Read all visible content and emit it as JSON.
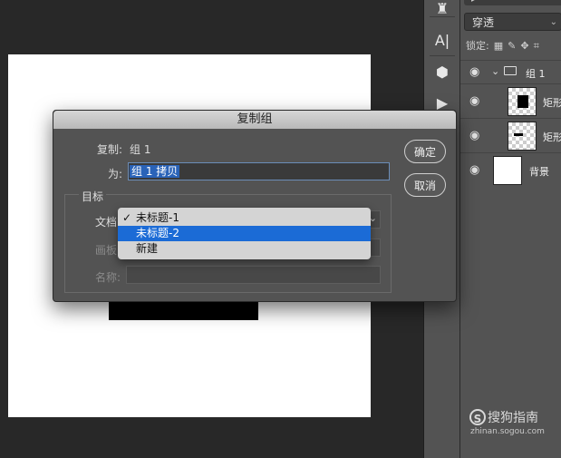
{
  "tools": [
    {
      "icon": "stamp-icon",
      "glyph": "♜"
    },
    {
      "icon": "text-options-icon",
      "glyph": "A|"
    },
    {
      "icon": "3d-cube-icon",
      "glyph": "⬢"
    },
    {
      "icon": "play-icon",
      "glyph": "▶"
    }
  ],
  "layers_panel": {
    "blend_mode": "穿透",
    "lock_label": "锁定:",
    "layers": [
      {
        "name": "组 1"
      },
      {
        "name": "矩形"
      },
      {
        "name": "矩形"
      },
      {
        "name": "背景"
      }
    ]
  },
  "dialog": {
    "title": "复制组",
    "duplicate_label": "复制:",
    "duplicate_value": "组 1",
    "as_label": "为:",
    "as_value": "组 1 拷贝",
    "target_legend": "目标",
    "document_label": "文档",
    "artboard_label": "画板",
    "name_label": "名称:",
    "ok_label": "确定",
    "cancel_label": "取消"
  },
  "dropdown": {
    "options": [
      {
        "label": "未标题-1",
        "checked": true
      },
      {
        "label": "未标题-2",
        "highlighted": true
      },
      {
        "label": "新建"
      }
    ]
  },
  "watermark": {
    "name": "搜狗指南",
    "url": "zhinan.sogou.com",
    "logo": "S"
  },
  "colors": {
    "highlight": "#1b6bd6",
    "selection": "#2a63b8"
  }
}
